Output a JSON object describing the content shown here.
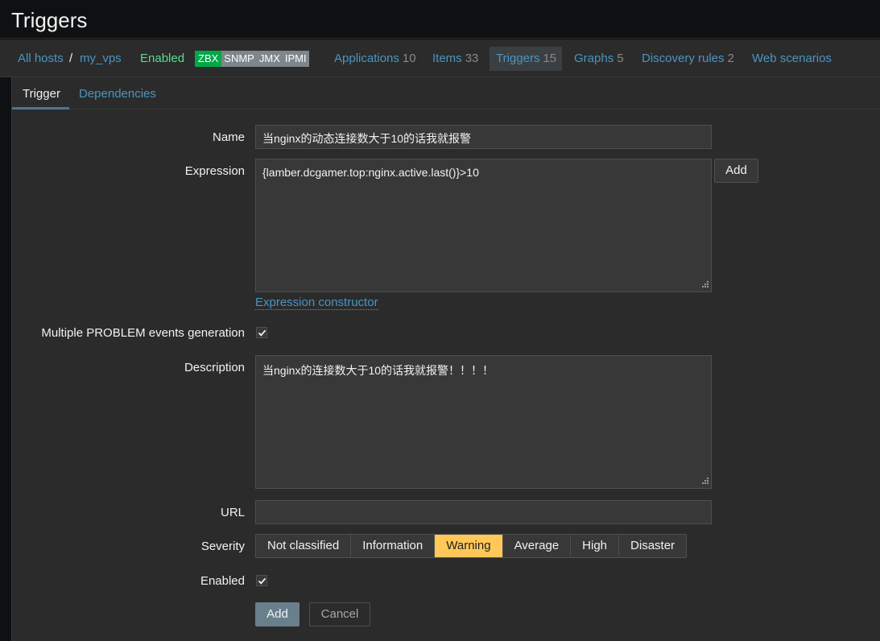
{
  "page": {
    "title": "Triggers"
  },
  "host_nav": {
    "all_hosts": "All hosts",
    "separator": "/",
    "host": "my_vps",
    "status": "Enabled",
    "availability": [
      "ZBX",
      "SNMP",
      "JMX",
      "IPMI"
    ],
    "applications": {
      "label": "Applications",
      "count": "10"
    },
    "items": {
      "label": "Items",
      "count": "33"
    },
    "triggers": {
      "label": "Triggers",
      "count": "15"
    },
    "graphs": {
      "label": "Graphs",
      "count": "5"
    },
    "discovery": {
      "label": "Discovery rules",
      "count": "2"
    },
    "web": {
      "label": "Web scenarios"
    }
  },
  "tabs": {
    "trigger": "Trigger",
    "dependencies": "Dependencies"
  },
  "form": {
    "name_label": "Name",
    "name_value": "当nginx的动态连接数大于10的话我就报警",
    "expression_label": "Expression",
    "expression_value": "{lamber.dcgamer.top:nginx.active.last()}>10",
    "expression_add": "Add",
    "expression_constructor": "Expression constructor",
    "multiple_label": "Multiple PROBLEM events generation",
    "multiple_checked": true,
    "description_label": "Description",
    "description_value": "当nginx的连接数大于10的话我就报警！！！！",
    "url_label": "URL",
    "url_value": "",
    "severity_label": "Severity",
    "severity_options": [
      "Not classified",
      "Information",
      "Warning",
      "Average",
      "High",
      "Disaster"
    ],
    "severity_selected": "Warning",
    "enabled_label": "Enabled",
    "enabled_checked": true,
    "add_button": "Add",
    "cancel_button": "Cancel"
  },
  "colors": {
    "link": "#4796c4",
    "enabled": "#59db8f",
    "zbx_available": "#00a848",
    "warning": "#ffc859",
    "primary_button": "#697f8c"
  }
}
